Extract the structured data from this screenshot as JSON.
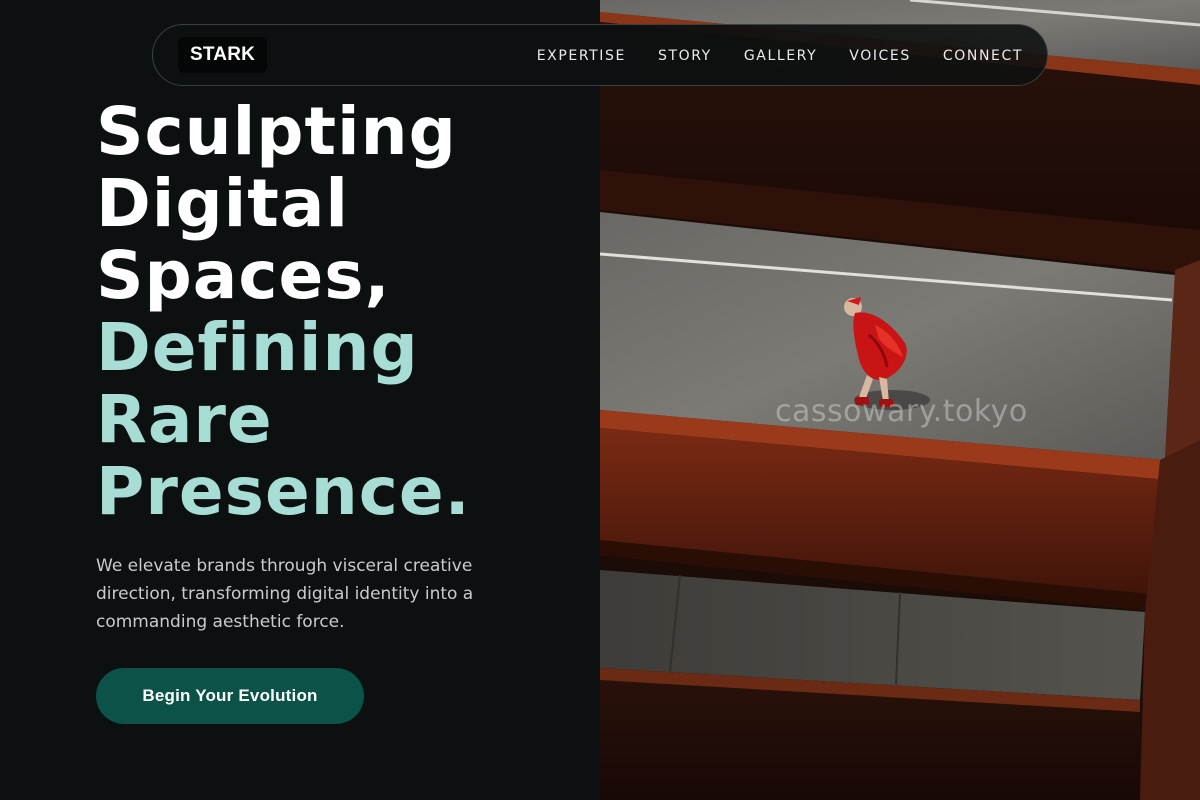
{
  "nav": {
    "logo": "STARK",
    "links": [
      "EXPERTISE",
      "STORY",
      "GALLERY",
      "VOICES",
      "CONNECT"
    ]
  },
  "hero": {
    "headline_white": [
      "Sculpting",
      "Digital",
      "Spaces,"
    ],
    "headline_mint": [
      "Defining",
      "Rare",
      "Presence."
    ],
    "subtext": "We elevate brands through visceral creative direction, transforming digital identity into a commanding aesthetic force.",
    "cta_label": "Begin Your Evolution"
  },
  "image": {
    "watermark": "cassowary.tokyo"
  },
  "colors": {
    "background": "#0c1010",
    "accent_text": "#a8ddd6",
    "cta_bg": "#0b5248",
    "figure_red": "#d21a1a"
  }
}
